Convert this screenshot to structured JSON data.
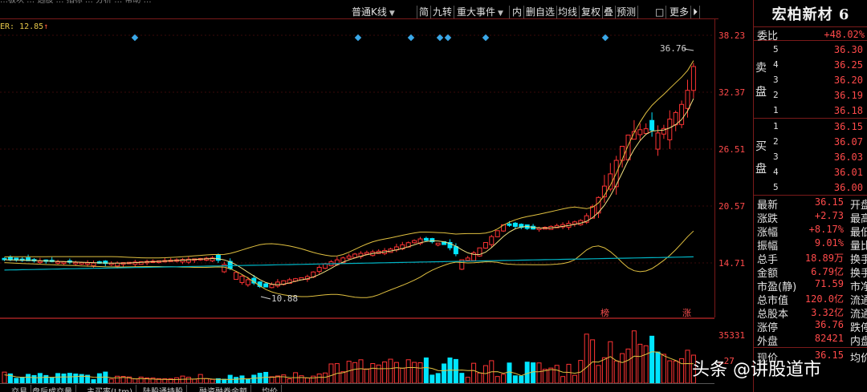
{
  "toolbar": {
    "sliver_text": "…板块 … 选股 … 指标 … 分析 … 帮助 …",
    "kline_type": "普通K线",
    "buttons": [
      "简",
      "九转",
      "重大事件",
      "内",
      "删自选",
      "均线",
      "复权",
      "叠",
      "预测",
      "□",
      "更多",
      "⏵"
    ]
  },
  "indicator": {
    "label": "ER: 12.85",
    "arrow": "↑"
  },
  "price_axis": [
    "38.23",
    "32.37",
    "26.51",
    "20.57",
    "14.71"
  ],
  "volume_axis": [
    "35331",
    "…27"
  ],
  "price_annotations": {
    "high": "36.76",
    "low": "10.88"
  },
  "event_markers": {
    "bang": "榜",
    "zhang": "涨"
  },
  "colors": {
    "up": "#ff3333",
    "down": "#00e5ff",
    "ma_short": "#f0d060",
    "ma_long": "#00c0c0",
    "bg": "#000000"
  },
  "stock": {
    "name": "宏柏新材 6"
  },
  "weibi": {
    "label": "委比",
    "value": "+48.02%"
  },
  "sell": {
    "side_label_top": "卖",
    "side_label_bottom": "盘",
    "levels": [
      {
        "lvl": "5",
        "price": "36.30"
      },
      {
        "lvl": "4",
        "price": "36.25"
      },
      {
        "lvl": "3",
        "price": "36.20"
      },
      {
        "lvl": "2",
        "price": "36.19"
      },
      {
        "lvl": "1",
        "price": "36.18"
      }
    ]
  },
  "buy": {
    "side_label_top": "买",
    "side_label_bottom": "盘",
    "levels": [
      {
        "lvl": "1",
        "price": "36.15"
      },
      {
        "lvl": "2",
        "price": "36.07"
      },
      {
        "lvl": "3",
        "price": "36.03"
      },
      {
        "lvl": "4",
        "price": "36.01"
      },
      {
        "lvl": "5",
        "price": "36.00"
      }
    ]
  },
  "stats": [
    {
      "key": "最新",
      "value": "36.15",
      "key2": "开盘"
    },
    {
      "key": "涨跌",
      "value": "+2.73",
      "key2": "最高"
    },
    {
      "key": "涨幅",
      "value": "+8.17%",
      "key2": "最低"
    },
    {
      "key": "振幅",
      "value": "9.01%",
      "key2": "量比"
    },
    {
      "key": "总手",
      "value": "18.89万",
      "key2": "换手"
    },
    {
      "key": "金额",
      "value": "6.79亿",
      "key2": "换手"
    },
    {
      "key": "市盈(静)",
      "value": "71.59",
      "key2": "市净"
    },
    {
      "key": "总市值",
      "value": "120.0亿",
      "key2": "流通"
    },
    {
      "key": "总股本",
      "value": "3.32亿",
      "key2": "流通"
    },
    {
      "key": "涨停",
      "value": "36.76",
      "key2": "跌停"
    },
    {
      "key": "外盘",
      "value": "82421",
      "key2": "内盘"
    }
  ],
  "bottom_panel": {
    "label": "现价",
    "value": "36.15",
    "label2": "均价"
  },
  "bottom_tabs": [
    "…交易",
    "盘后成交量",
    "主买率(Ltm)",
    "陆股通持股",
    "融资融券余额",
    "均价"
  ],
  "watermark": "头条 @讲股道市"
}
